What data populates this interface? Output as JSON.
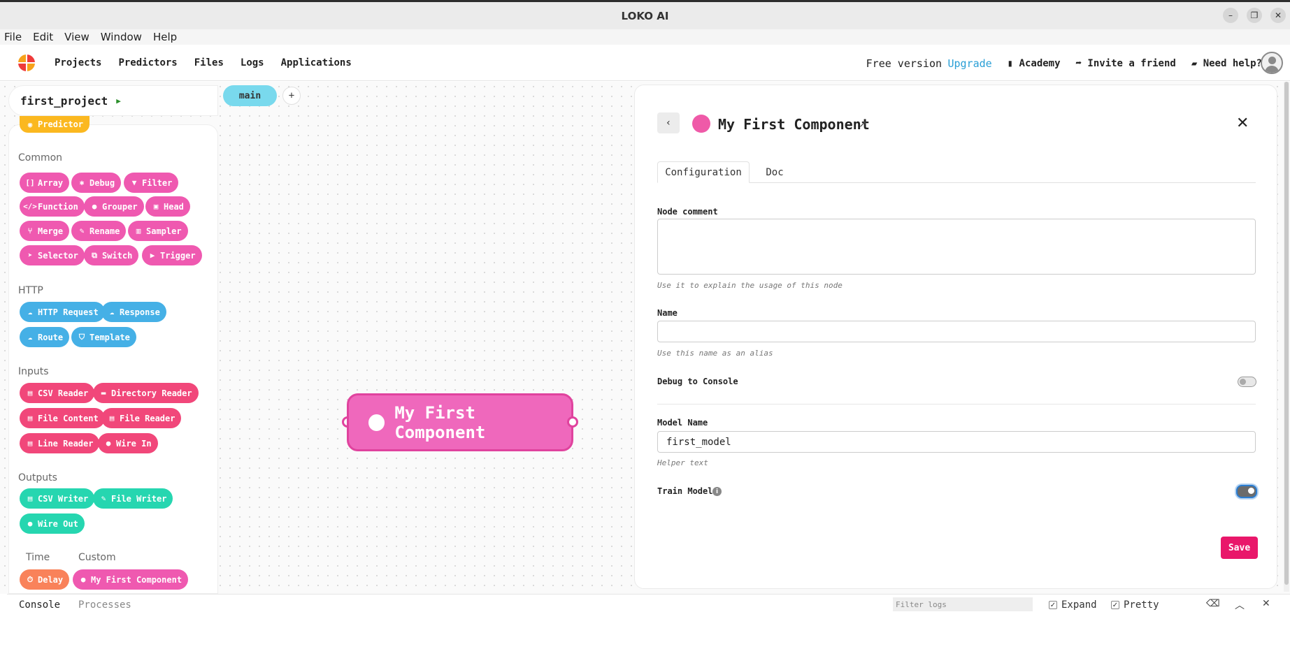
{
  "window": {
    "title": "LOKO AI"
  },
  "menubar": [
    "File",
    "Edit",
    "View",
    "Window",
    "Help"
  ],
  "nav": {
    "items": [
      "Projects",
      "Predictors",
      "Files",
      "Logs",
      "Applications"
    ],
    "free_version": "Free version",
    "upgrade": "Upgrade",
    "academy": "Academy",
    "invite": "Invite a friend",
    "help": "Need help?"
  },
  "project": {
    "name": "first_project",
    "tab": "main"
  },
  "palette": {
    "top_partial": {
      "label": "Predictor",
      "icon": "predictor-icon"
    },
    "sections": {
      "common": "Common",
      "http": "HTTP",
      "inputs": "Inputs",
      "outputs": "Outputs",
      "time": "Time",
      "custom": "Custom"
    },
    "common": [
      {
        "label": "Array",
        "icon": "brackets-icon"
      },
      {
        "label": "Debug",
        "icon": "bug-icon"
      },
      {
        "label": "Filter",
        "icon": "filter-icon"
      },
      {
        "label": "Function",
        "icon": "code-icon"
      },
      {
        "label": "Grouper",
        "icon": "users-icon"
      },
      {
        "label": "Head",
        "icon": "head-icon"
      },
      {
        "label": "Merge",
        "icon": "merge-icon"
      },
      {
        "label": "Rename",
        "icon": "pencil-icon"
      },
      {
        "label": "Sampler",
        "icon": "bar-chart-icon"
      },
      {
        "label": "Selector",
        "icon": "cursor-icon"
      },
      {
        "label": "Switch",
        "icon": "switch-icon"
      },
      {
        "label": "Trigger",
        "icon": "play-icon"
      }
    ],
    "http": [
      {
        "label": "HTTP Request",
        "icon": "cloud-upload-icon"
      },
      {
        "label": "Response",
        "icon": "cloud-download-icon"
      },
      {
        "label": "Route",
        "icon": "cloud-icon"
      },
      {
        "label": "Template",
        "icon": "html-icon"
      }
    ],
    "inputs": [
      {
        "label": "CSV Reader",
        "icon": "csv-file-icon"
      },
      {
        "label": "Directory Reader",
        "icon": "folder-icon"
      },
      {
        "label": "File Content",
        "icon": "file-text-icon"
      },
      {
        "label": "File Reader",
        "icon": "file-edit-icon"
      },
      {
        "label": "Line Reader",
        "icon": "file-line-icon"
      },
      {
        "label": "Wire In",
        "icon": "circle-icon"
      }
    ],
    "outputs": [
      {
        "label": "CSV Writer",
        "icon": "csv-file-icon"
      },
      {
        "label": "File Writer",
        "icon": "file-pen-icon"
      },
      {
        "label": "Wire Out",
        "icon": "circle-icon"
      }
    ],
    "time": [
      {
        "label": "Delay",
        "icon": "stopwatch-icon"
      }
    ],
    "custom": [
      {
        "label": "My First Component",
        "icon": "circle-icon"
      }
    ]
  },
  "canvas": {
    "node_label": "My First Component"
  },
  "panel": {
    "title": "My First Component",
    "tabs": {
      "configuration": "Configuration",
      "doc": "Doc"
    },
    "node_comment": {
      "label": "Node comment",
      "value": "",
      "help": "Use it to explain the usage of this node"
    },
    "name": {
      "label": "Name",
      "value": "",
      "help": "Use this name as an alias"
    },
    "debug": {
      "label": "Debug to Console",
      "on": false
    },
    "model_name": {
      "label": "Model Name",
      "value": "first_model",
      "help": "Helper text"
    },
    "train_model": {
      "label": "Train Model",
      "on": true
    },
    "save": "Save"
  },
  "console": {
    "tabs": {
      "console": "Console",
      "processes": "Processes"
    },
    "filter_placeholder": "Filter logs",
    "expand": "Expand",
    "pretty": "Pretty"
  },
  "colors": {
    "common": "#ef59b0",
    "http": "#45b0e6",
    "inputs": "#f1477a",
    "outputs": "#26d6b0",
    "time": "#f9825a",
    "predictor": "#fbb820",
    "save": "#e9176a",
    "upgrade": "#2a9fd6"
  }
}
